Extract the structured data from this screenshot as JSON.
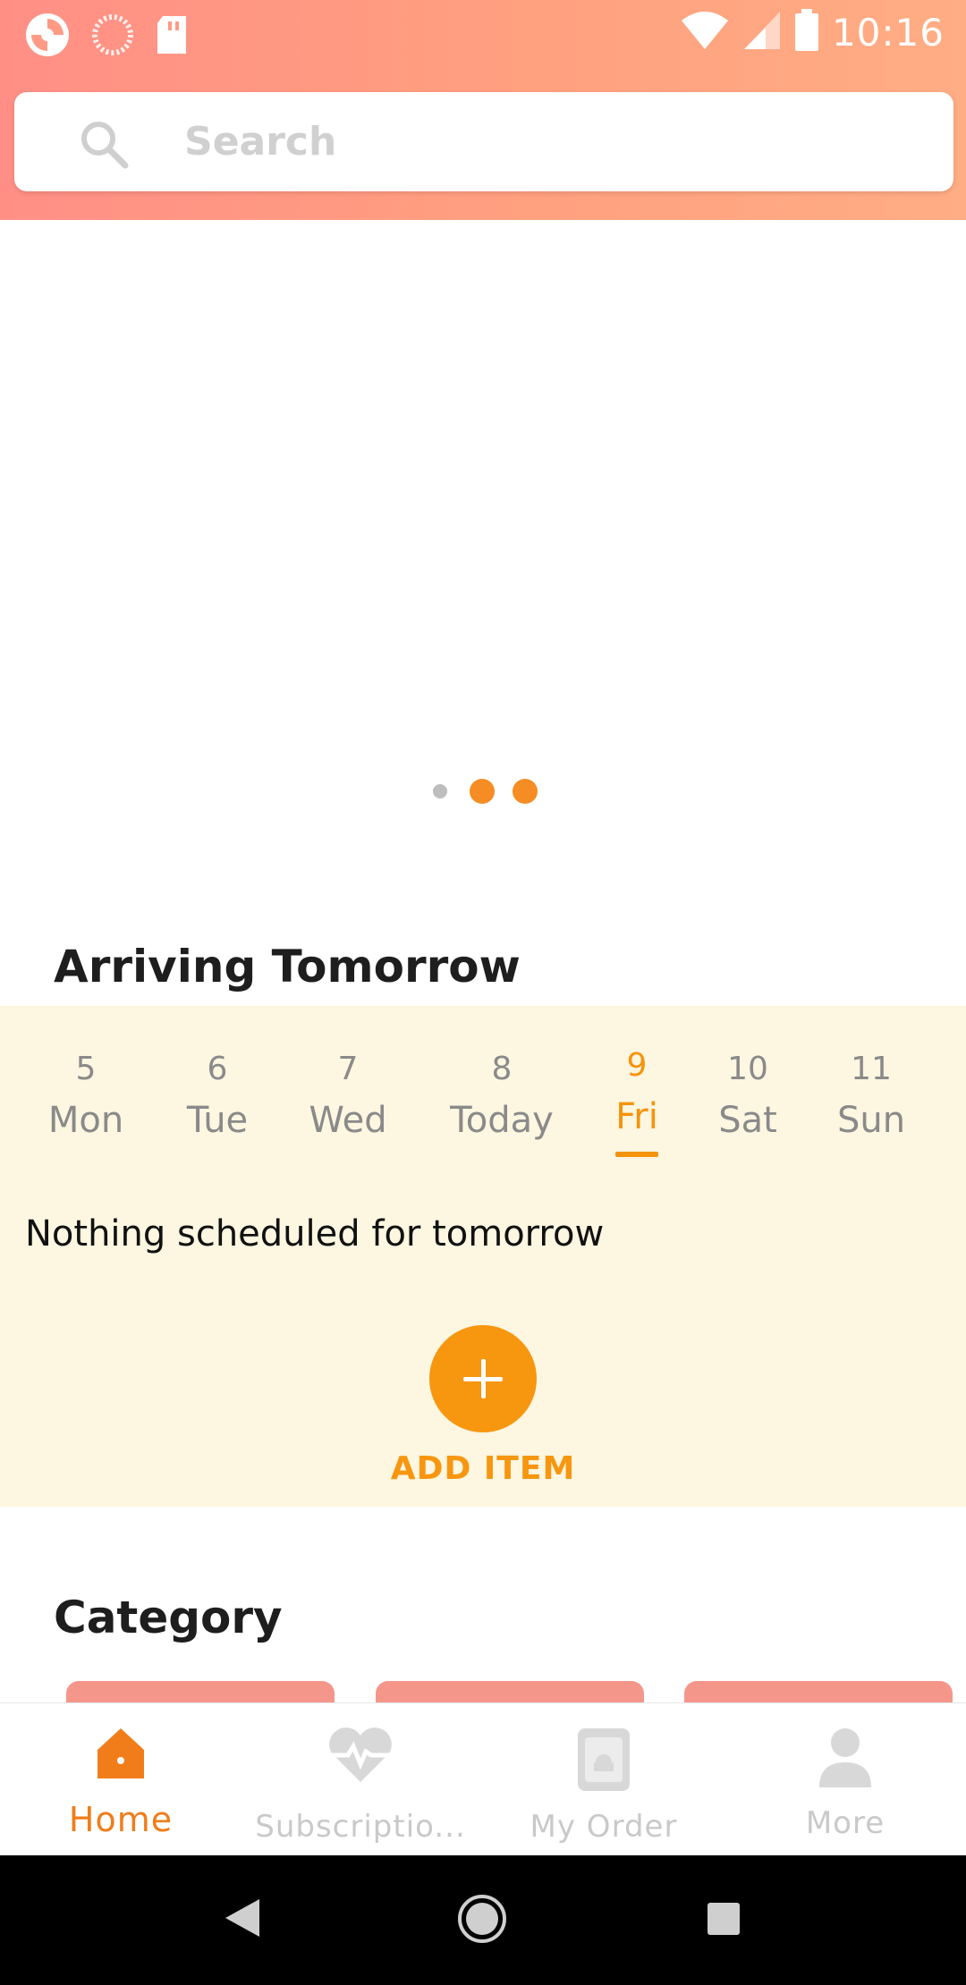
{
  "status_bar": {
    "time": "10:16",
    "left_icons": [
      "app-notification-icon",
      "loading-icon",
      "sd-card-icon"
    ],
    "right_icons": [
      "wifi-icon",
      "cell-signal-icon",
      "battery-icon"
    ]
  },
  "search": {
    "placeholder": "Search",
    "icon": "search-icon"
  },
  "carousel": {
    "dots": 3,
    "active_index": 2
  },
  "arriving": {
    "title": "Arriving Tomorrow",
    "days": [
      {
        "num": "5",
        "name": "Mon"
      },
      {
        "num": "6",
        "name": "Tue"
      },
      {
        "num": "7",
        "name": "Wed"
      },
      {
        "num": "8",
        "name": "Today"
      },
      {
        "num": "9",
        "name": "Fri"
      },
      {
        "num": "10",
        "name": "Sat"
      },
      {
        "num": "11",
        "name": "Sun"
      }
    ],
    "selected_day": "Fri",
    "empty_message": "Nothing scheduled for tomorrow",
    "add_label": "ADD ITEM"
  },
  "category": {
    "title": "Category"
  },
  "bottom_nav": {
    "items": [
      {
        "label": "Home",
        "icon": "home-icon",
        "active": true
      },
      {
        "label": "Subscriptio...",
        "icon": "heartbeat-icon",
        "active": false
      },
      {
        "label": "My Order",
        "icon": "order-book-icon",
        "active": false
      },
      {
        "label": "More",
        "icon": "person-icon",
        "active": false
      }
    ]
  },
  "colors": {
    "accent": "#f7960f",
    "header_gradient_start": "#ff8f86",
    "header_gradient_end": "#ffad84",
    "panel_background": "#fdf6e0"
  }
}
